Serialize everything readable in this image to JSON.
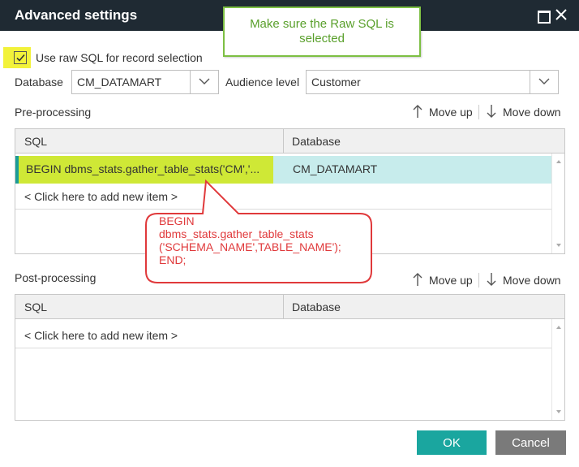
{
  "dialog": {
    "title": "Advanced settings",
    "buttons": {
      "ok": "OK",
      "cancel": "Cancel"
    }
  },
  "callouts": {
    "green": {
      "line1": "Make sure the Raw SQL is",
      "line2": "selected"
    },
    "red": {
      "lines": [
        "BEGIN",
        "dbms_stats.gather_table_stats",
        "('SCHEMA_NAME',TABLE_NAME');",
        "END;"
      ]
    }
  },
  "form": {
    "raw_sql_label": "Use raw SQL for record selection",
    "raw_sql_checked": true,
    "database_label": "Database",
    "database_value": "CM_DATAMART",
    "audience_label": "Audience level",
    "audience_value": "Customer"
  },
  "pre_processing": {
    "title": "Pre-processing",
    "move_up": "Move up",
    "move_down": "Move down",
    "columns": [
      "SQL",
      "Database"
    ],
    "rows": [
      {
        "sql": "BEGIN dbms_stats.gather_table_stats('CM','...",
        "database": "CM_DATAMART"
      }
    ],
    "add_item": "< Click here to add new item >"
  },
  "post_processing": {
    "title": "Post-processing",
    "move_up": "Move up",
    "move_down": "Move down",
    "columns": [
      "SQL",
      "Database"
    ],
    "add_item": "< Click here to add new item >"
  },
  "colors": {
    "titlebar": "#1f2a33",
    "accent": "#1aa69f",
    "highlight_yellow": "#f2f23a",
    "selected_row": "#c7ecec",
    "callout_red": "#e0393b",
    "callout_green": "#7dbf43"
  },
  "icons": [
    "maximize-icon",
    "close-icon",
    "check-icon",
    "chevron-down-icon",
    "arrow-up-icon",
    "arrow-down-icon"
  ]
}
